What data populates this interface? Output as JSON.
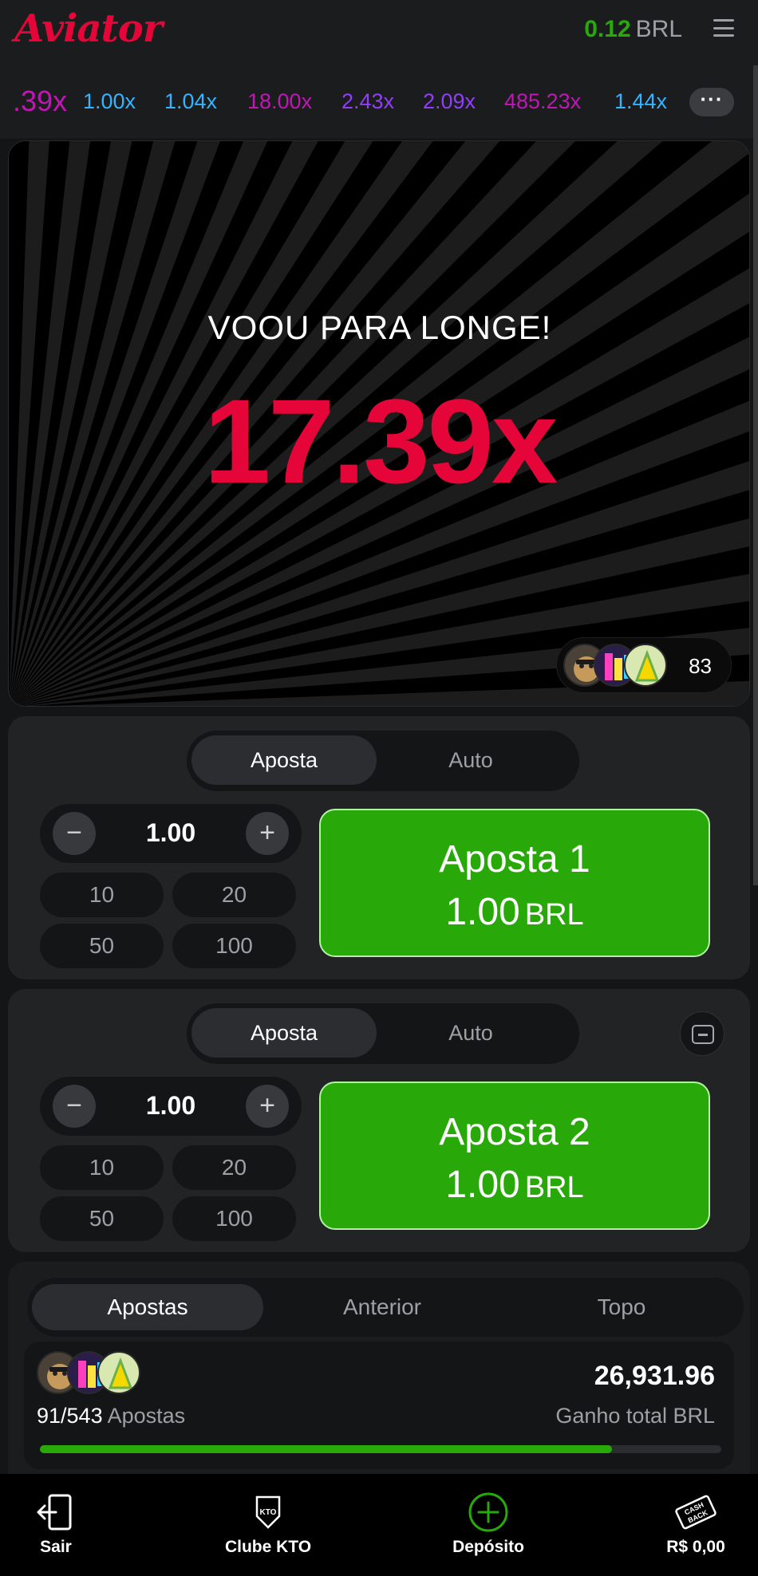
{
  "header": {
    "logo": "Aviator",
    "balance_amount": "0.12",
    "balance_currency": "BRL"
  },
  "history": [
    {
      "value": ".39x",
      "color": "#c017b4"
    },
    {
      "value": "1.00x",
      "color": "#34b4ff"
    },
    {
      "value": "1.04x",
      "color": "#34b4ff"
    },
    {
      "value": "18.00x",
      "color": "#c017b4"
    },
    {
      "value": "2.43x",
      "color": "#913ef8"
    },
    {
      "value": "2.09x",
      "color": "#913ef8"
    },
    {
      "value": "485.23x",
      "color": "#c017b4"
    },
    {
      "value": "1.44x",
      "color": "#34b4ff"
    }
  ],
  "game": {
    "status_text": "VOOU PARA LONGE!",
    "multiplier": "17.39x",
    "players_count": "83"
  },
  "bet_panels": [
    {
      "tab_bet": "Aposta",
      "tab_auto": "Auto",
      "amount": "1.00",
      "minus": "−",
      "plus": "+",
      "quick": [
        "10",
        "20",
        "50",
        "100"
      ],
      "button_title": "Aposta 1",
      "button_amount": "1.00",
      "button_currency": "BRL"
    },
    {
      "tab_bet": "Aposta",
      "tab_auto": "Auto",
      "amount": "1.00",
      "minus": "−",
      "plus": "+",
      "quick": [
        "10",
        "20",
        "50",
        "100"
      ],
      "button_title": "Aposta 2",
      "button_amount": "1.00",
      "button_currency": "BRL"
    }
  ],
  "bets": {
    "tabs": [
      "Apostas",
      "Anterior",
      "Topo"
    ],
    "total_win": "26,931.96",
    "total_win_label": "Ganho total BRL",
    "bet_count": "91/543",
    "bet_count_label": "Apostas",
    "progress_fraction": 0.84
  },
  "nav": {
    "exit": "Sair",
    "club": "Clube KTO",
    "deposit": "Depósito",
    "cashback": "R$ 0,00",
    "club_icon_text": "KTO",
    "cashback_icon_text_1": "CASH",
    "cashback_icon_text_2": "BACK"
  },
  "colors": {
    "accent_red": "#e50539",
    "accent_green": "#28a909"
  },
  "icons": [
    "menu-icon",
    "more-icon",
    "minus-icon",
    "plus-icon",
    "remove-bet-icon",
    "exit-icon",
    "club-icon",
    "deposit-icon",
    "cashback-icon"
  ]
}
